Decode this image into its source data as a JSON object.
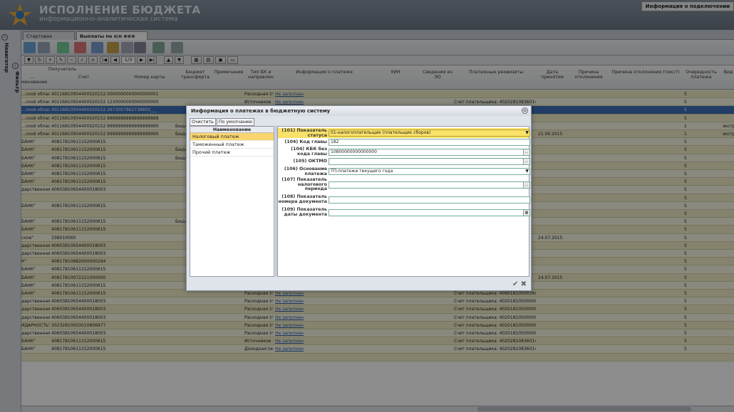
{
  "app": {
    "title": "ИСПОЛНЕНИЕ БЮДЖЕТА",
    "subtitle": "информационно-аналитическая система",
    "conn_info": "Информация о подключении"
  },
  "side": {
    "navigator": "Навигатор",
    "filter": "Фильтр"
  },
  "tabs": [
    {
      "label": "Стартовая страница"
    },
    {
      "label": "Выплаты по п/п"
    }
  ],
  "pager": "1/3",
  "grid": {
    "headers": [
      "Получатель",
      "…менование",
      "Счет",
      "Номер карты",
      "Бюджет трансферта",
      "Примечание",
      "Тип БК и направлен",
      "Информация о платеже",
      "УИН",
      "Сведения из ЭО",
      "Платежные реквизиты",
      "Дата принятия",
      "Причина отклонения",
      "Причина отклонения (текст)",
      "Очередность платежа",
      "Вид"
    ],
    "rows": [
      {
        "n": "…ской области",
        "acc": "40116810954400020152",
        "card": "0000000000000000001",
        "a": "",
        "b": "Расходная (по",
        "c": "Не заполнено",
        "d": "",
        "e": "",
        "f": "5",
        "g": "",
        "cls": "ylw"
      },
      {
        "n": "…ской области",
        "acc": "40116810954400020152",
        "card": "1230000000000000000",
        "a": "",
        "b": "Источников",
        "c": "Не заполнено",
        "d": "Счет плательщика: 402028108360140",
        "e": "",
        "f": "5",
        "g": "",
        "cls": "lyl"
      },
      {
        "n": "…ской области",
        "acc": "40116810954400020152",
        "card": "2673057962739603___",
        "a": "",
        "b": "",
        "c": "",
        "d": "",
        "e": "",
        "f": "5",
        "g": "",
        "cls": "sel"
      },
      {
        "n": "…ской области",
        "acc": "40116810954400020152",
        "card": "8888888888888888888",
        "a": "",
        "b": "",
        "c": "",
        "d": "",
        "e": "",
        "f": "5",
        "g": "",
        "cls": "ylw"
      },
      {
        "n": "…ской области",
        "acc": "40116810954400020152",
        "card": "9999999999999999990",
        "a": "Бюдж",
        "b": "",
        "c": "",
        "d": "",
        "e": "",
        "f": "1",
        "g": "экстре",
        "cls": "lyl"
      },
      {
        "n": "…ской области",
        "acc": "40116810954400020152",
        "card": "9999999999999999990",
        "a": "Бюдж",
        "b": "",
        "c": "",
        "d": "",
        "e": "21.06.2015",
        "f": "1",
        "g": "экстре",
        "cls": "ylw"
      },
      {
        "n": "БАНК\"",
        "acc": "40817810611152000615",
        "card": "",
        "a": "",
        "b": "",
        "c": "",
        "d": "",
        "e": "",
        "f": "5",
        "g": "",
        "cls": "lyl"
      },
      {
        "n": "БАНК\"",
        "acc": "40817810611152000615",
        "card": "",
        "a": "Бюдж",
        "b": "",
        "c": "",
        "d": "",
        "e": "",
        "f": "5",
        "g": "",
        "cls": "ylw"
      },
      {
        "n": "БАНК\"",
        "acc": "40817810611152000615",
        "card": "",
        "a": "Бюдж",
        "b": "",
        "c": "",
        "d": "",
        "e": "",
        "f": "5",
        "g": "",
        "cls": "lyl"
      },
      {
        "n": "БАНК\"",
        "acc": "40817810611152000615",
        "card": "",
        "a": "",
        "b": "",
        "c": "",
        "d": "",
        "e": "",
        "f": "5",
        "g": "",
        "cls": "ylw"
      },
      {
        "n": "БАНК\"",
        "acc": "40817810611152000615",
        "card": "",
        "a": "",
        "b": "",
        "c": "",
        "d": "",
        "e": "",
        "f": "5",
        "g": "",
        "cls": "lyl"
      },
      {
        "n": "БАНК\"",
        "acc": "40817810611152000615",
        "card": "",
        "a": "",
        "b": "",
        "c": "",
        "d": "",
        "e": "",
        "f": "5",
        "g": "",
        "cls": "ylw"
      },
      {
        "n": "дарственная эк",
        "acc": "40603810654400018003",
        "card": "",
        "a": "",
        "b": "",
        "c": "",
        "d": "",
        "e": "",
        "f": "5",
        "g": "",
        "cls": "lyl"
      },
      {
        "n": "",
        "acc": "",
        "card": "",
        "a": "",
        "b": "",
        "c": "",
        "d": "",
        "e": "",
        "f": "5",
        "g": "",
        "cls": "ylw"
      },
      {
        "n": "БАНК\"",
        "acc": "40817810611152000615",
        "card": "",
        "a": "",
        "b": "",
        "c": "",
        "d": "",
        "e": "",
        "f": "5",
        "g": "",
        "cls": "lyl"
      },
      {
        "n": "",
        "acc": "",
        "card": "",
        "a": "",
        "b": "",
        "c": "",
        "d": "",
        "e": "",
        "f": "5",
        "g": "",
        "cls": "ylw"
      },
      {
        "n": "БАНК\"",
        "acc": "40817810611152000615",
        "card": "",
        "a": "Бюдж",
        "b": "",
        "c": "",
        "d": "",
        "e": "",
        "f": "5",
        "g": "",
        "cls": "lyl"
      },
      {
        "n": "БАНК\"",
        "acc": "40817810611152000615",
        "card": "",
        "a": "",
        "b": "",
        "c": "",
        "d": "",
        "e": "",
        "f": "5",
        "g": "",
        "cls": "ylw"
      },
      {
        "n": "ское\"",
        "acc": "338010060",
        "card": "",
        "a": "",
        "b": "",
        "c": "",
        "d": "",
        "e": "24.07.2015",
        "f": "5",
        "g": "",
        "cls": "lyl"
      },
      {
        "n": "дарственная эк",
        "acc": "40603810654400018003",
        "card": "",
        "a": "",
        "b": "",
        "c": "",
        "d": "",
        "e": "",
        "f": "5",
        "g": "",
        "cls": "ylw"
      },
      {
        "n": "дарственная эк",
        "acc": "40603810654400018003",
        "card": "",
        "a": "",
        "b": "",
        "c": "",
        "d": "",
        "e": "",
        "f": "5",
        "g": "",
        "cls": "lyl"
      },
      {
        "n": "К\"",
        "acc": "40817810882000000294",
        "card": "",
        "a": "",
        "b": "",
        "c": "",
        "d": "",
        "e": "",
        "f": "5",
        "g": "",
        "cls": "ylw"
      },
      {
        "n": "БАНК\"",
        "acc": "40817810611152000615",
        "card": "",
        "a": "",
        "b": "",
        "c": "",
        "d": "",
        "e": "",
        "f": "5",
        "g": "",
        "cls": "lyl"
      },
      {
        "n": "БАНК\"",
        "acc": "40817810072221000000",
        "card": "",
        "a": "",
        "b": "",
        "c": "",
        "d": "",
        "e": "24.07.2015",
        "f": "5",
        "g": "",
        "cls": "ylw"
      },
      {
        "n": "БАНК\"",
        "acc": "40817810611152000615",
        "card": "",
        "a": "",
        "b": "",
        "c": "",
        "d": "",
        "e": "",
        "f": "5",
        "g": "",
        "cls": "lyl"
      },
      {
        "n": "БАНК\"",
        "acc": "40817810611152000615",
        "card": "",
        "a": "",
        "b": "Расходная (по",
        "c": "Не заполнено",
        "d": "Счет плательщика: 406018105003601300",
        "e": "",
        "f": "5",
        "g": "",
        "cls": "ylw"
      },
      {
        "n": "дарственная эк",
        "acc": "40603810654400018003",
        "card": "",
        "a": "",
        "b": "Расходная (по",
        "c": "Не заполнено",
        "d": "Счет плательщика: 402018105000001",
        "e": "",
        "f": "5",
        "g": "",
        "cls": "lyl"
      },
      {
        "n": "дарственная эк",
        "acc": "40603810654400018003",
        "card": "",
        "a": "",
        "b": "Расходная (по",
        "c": "Не заполнено",
        "d": "Счет плательщика: 402018105000001",
        "e": "",
        "f": "5",
        "g": "",
        "cls": "ylw"
      },
      {
        "n": "дарственная эк",
        "acc": "40603810654400018003",
        "card": "",
        "a": "",
        "b": "Расходная (по",
        "c": "Не заполнено",
        "d": "Счет плательщика: 402018105000001",
        "e": "",
        "f": "5",
        "g": "",
        "cls": "lyl"
      },
      {
        "n": "ИДАРНОСТЬ\"",
        "acc": "30232810003010806977",
        "card": "",
        "a": "",
        "b": "Расходная (по",
        "c": "Не заполнено",
        "d": "Счет плательщика: 402018105000001",
        "e": "",
        "f": "5",
        "g": "",
        "cls": "ylw"
      },
      {
        "n": "дарственная эк",
        "acc": "40603810654400018003",
        "card": "",
        "a": "",
        "b": "Расходная (по",
        "c": "Не заполнено",
        "d": "Счет плательщика: 402018105000001",
        "e": "",
        "f": "5",
        "g": "",
        "cls": "lyl"
      },
      {
        "n": "БАНК\"",
        "acc": "40817810611152000615",
        "card": "",
        "a": "",
        "b": "Источников",
        "c": "Не заполнено",
        "d": "Счет плательщика: 402028108360140",
        "e": "",
        "f": "5",
        "g": "",
        "cls": "ylw"
      },
      {
        "n": "БАНК\"",
        "acc": "40817810611152000615",
        "card": "",
        "a": "",
        "b": "Доходная (исп",
        "c": "Не заполнено",
        "d": "Счет плательщика: 402028108360140",
        "e": "",
        "f": "5",
        "g": "",
        "cls": "lyl"
      },
      {
        "n": "",
        "acc": "",
        "card": "",
        "a": "",
        "b": "",
        "c": "",
        "d": "",
        "e": "",
        "f": "",
        "g": "",
        "cls": "ylw"
      }
    ]
  },
  "dialog": {
    "title": "Информация о платежах в бюджетную систему",
    "clear": "Очистить",
    "default": "По умолчанию",
    "list_header": "Наименование",
    "list": [
      "Налоговый платеж",
      "Таможенный платеж",
      "Прочий платеж"
    ],
    "fields": [
      {
        "label": "(101) Показатель статуса",
        "value": "01-налогоплательщик (плательщик сборов)"
      },
      {
        "label": "(104) Код главы",
        "value": "182"
      },
      {
        "label": "(104) КБК без кода главы",
        "value": "10800000000000000"
      },
      {
        "label": "(105) ОКТМО",
        "value": ""
      },
      {
        "label": "(106) Основание платежа",
        "value": "ТП-платежи текущего года"
      },
      {
        "label": "(107) Показатель налогового периода",
        "value": ""
      },
      {
        "label": "(108) Показатель номера документа",
        "value": ""
      },
      {
        "label": "(109) Показатель даты документа",
        "value": ""
      }
    ]
  }
}
